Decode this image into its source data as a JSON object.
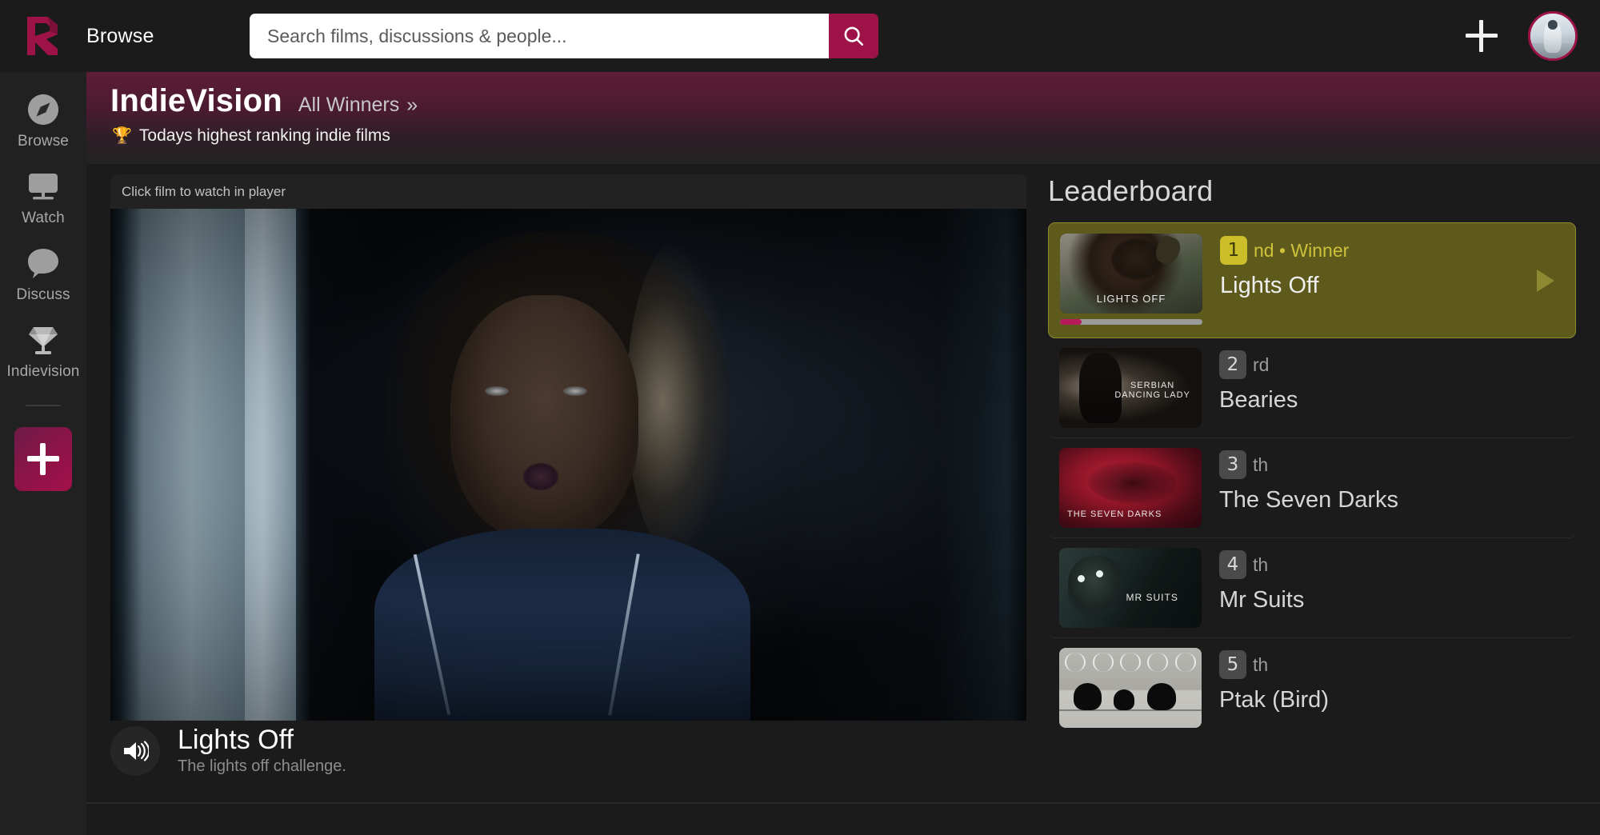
{
  "topbar": {
    "logo_icon": "r-logo-icon",
    "browse_label": "Browse",
    "search_placeholder": "Search films, discussions & people...",
    "search_value": "",
    "search_icon": "search-icon",
    "add_icon": "plus-icon",
    "avatar_icon": "avatar-astronaut"
  },
  "sidebar": {
    "items": [
      {
        "label": "Browse",
        "icon": "compass-icon"
      },
      {
        "label": "Watch",
        "icon": "monitor-icon"
      },
      {
        "label": "Discuss",
        "icon": "speech-bubble-icon"
      },
      {
        "label": "Indievision",
        "icon": "diamond-icon"
      }
    ],
    "create_icon": "plus-icon"
  },
  "banner": {
    "title": "IndieVision",
    "link_label": "All Winners",
    "link_chevron": "»",
    "trophy_icon": "🏆",
    "tagline": "Todays highest ranking indie films"
  },
  "player": {
    "hint": "Click film to watch in player",
    "speaker_icon": "volume-icon",
    "now_playing_title": "Lights Off",
    "now_playing_subtitle": "The lights off challenge."
  },
  "leaderboard": {
    "title": "Leaderboard",
    "play_icon": "play-triangle-icon",
    "items": [
      {
        "rank": "1",
        "suffix": "nd",
        "badge_note": "• Winner",
        "rank_line": "nd • Winner",
        "name": "Lights Off",
        "thumb_caption": "LIGHTS OFF",
        "progress_percent": 15,
        "active": true
      },
      {
        "rank": "2",
        "suffix": "rd",
        "rank_line": "rd",
        "name": "Bearies",
        "thumb_caption": "SERBIAN\nDANCING LADY",
        "active": false
      },
      {
        "rank": "3",
        "suffix": "th",
        "rank_line": "th",
        "name": "The Seven Darks",
        "thumb_caption": "THE SEVEN DARKS",
        "active": false
      },
      {
        "rank": "4",
        "suffix": "th",
        "rank_line": "th",
        "name": "Mr Suits",
        "thumb_caption": "MR SUITS",
        "active": false
      },
      {
        "rank": "5",
        "suffix": "th",
        "rank_line": "th",
        "name": "Ptak (Bird)",
        "thumb_caption": "",
        "active": false
      }
    ]
  },
  "colors": {
    "accent": "#9d1347",
    "accent_bright": "#b61a5a",
    "winner_bg": "#5d5a1c",
    "winner_badge": "#cbbe2a",
    "page_bg": "#1b1b1b",
    "sidebar_bg": "#212121",
    "banner_from": "#5e1d37"
  }
}
